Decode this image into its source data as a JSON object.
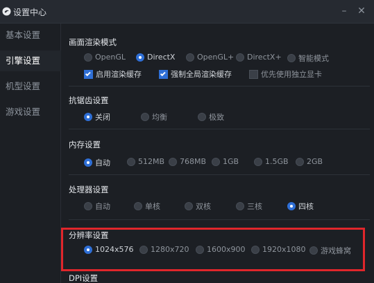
{
  "app": {
    "title": "设置中心",
    "minimize": "–",
    "close": "✕",
    "logo_icon": "app-logo-icon"
  },
  "sidebar": {
    "items": [
      {
        "label": "基本设置",
        "active": false
      },
      {
        "label": "引擎设置",
        "active": true
      },
      {
        "label": "机型设置",
        "active": false
      },
      {
        "label": "游戏设置",
        "active": false
      }
    ]
  },
  "render": {
    "title": "画面渲染模式",
    "options": [
      "OpenGL",
      "DirectX",
      "OpenGL+",
      "DirectX+",
      "智能模式"
    ],
    "selected": "DirectX",
    "checkboxes": [
      {
        "label": "启用渲染缓存",
        "checked": true
      },
      {
        "label": "强制全局渲染缓存",
        "checked": true
      },
      {
        "label": "优先使用独立显卡",
        "checked": false
      }
    ]
  },
  "antialias": {
    "title": "抗锯齿设置",
    "options": [
      "关闭",
      "均衡",
      "极致"
    ],
    "selected": "关闭"
  },
  "memory": {
    "title": "内存设置",
    "options": [
      "自动",
      "512MB",
      "768MB",
      "1GB",
      "1.5GB",
      "2GB"
    ],
    "selected": "自动"
  },
  "cpu": {
    "title": "处理器设置",
    "options": [
      "自动",
      "单核",
      "双核",
      "三核",
      "四核"
    ],
    "selected": "四核"
  },
  "resolution": {
    "title": "分辨率设置",
    "options": [
      "1024x576",
      "1280x720",
      "1600x900",
      "1920x1080",
      "游戏蜂窝"
    ],
    "selected": "1024x576"
  },
  "dpi": {
    "title": "DPI设置"
  },
  "colors": {
    "accent": "#2f6fd6",
    "highlight": "#e0262b",
    "background": "#1c1f24"
  }
}
